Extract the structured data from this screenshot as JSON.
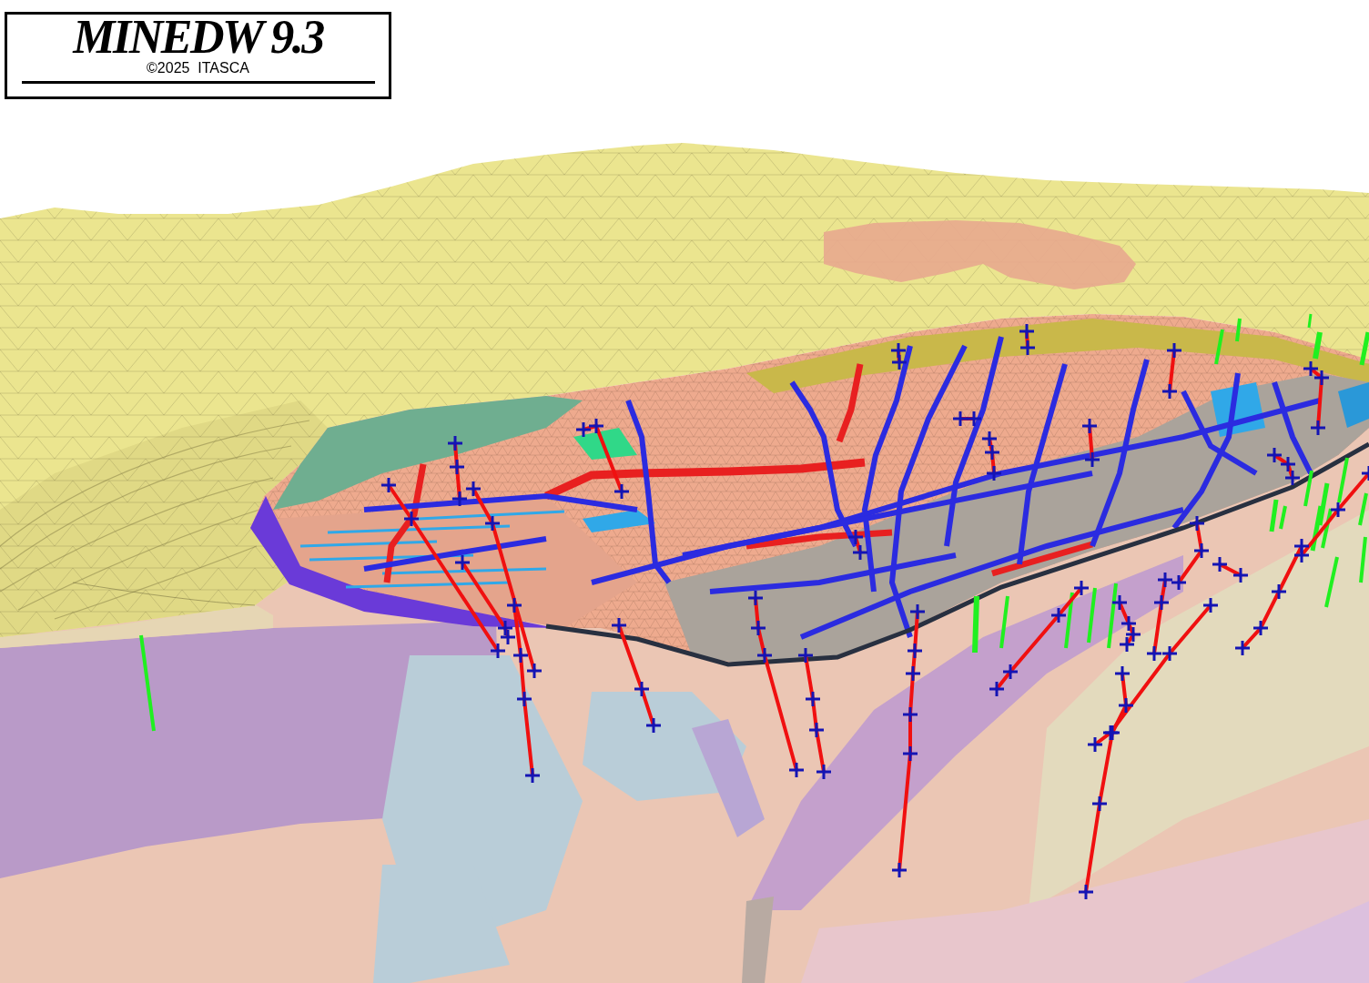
{
  "logo_box": {
    "title": "MINEDW 9.3",
    "copyright": "©2025  ITASCA"
  }
}
